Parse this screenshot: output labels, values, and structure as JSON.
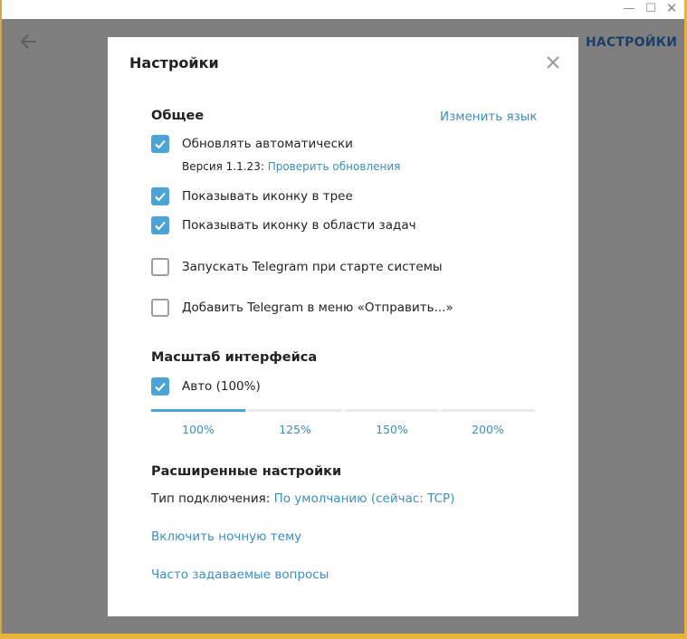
{
  "window": {
    "controls": {
      "minimize": "—",
      "maximize": "☐",
      "close": "✕"
    },
    "header_right": "НАСТРОЙКИ"
  },
  "modal": {
    "title": "Настройки",
    "general": {
      "title": "Общее",
      "change_language": "Изменить язык",
      "auto_update": {
        "label": "Обновлять автоматически",
        "checked": true
      },
      "version_prefix": "Версия 1.1.23:",
      "check_updates": "Проверить обновления",
      "tray_icon": {
        "label": "Показывать иконку в трее",
        "checked": true
      },
      "taskbar_icon": {
        "label": "Показывать иконку в области задач",
        "checked": true
      },
      "autostart": {
        "label": "Запускать Telegram при старте системы",
        "checked": false
      },
      "send_to_menu": {
        "label": "Добавить Telegram в меню «Отправить...»",
        "checked": false
      }
    },
    "scale": {
      "title": "Масштаб интерфейса",
      "auto": {
        "label": "Авто (100%)",
        "checked": true
      },
      "options": [
        "100%",
        "125%",
        "150%",
        "200%"
      ],
      "selected_index": 0
    },
    "advanced": {
      "title": "Расширенные настройки",
      "connection_prefix": "Тип подключения:",
      "connection_value": "По умолчанию (сейчас: TCP)",
      "night_mode": "Включить ночную тему",
      "faq": "Часто задаваемые вопросы"
    }
  },
  "colors": {
    "accent": "#4ba3d6",
    "link": "#3b8ec4",
    "overlay": "#7f7f7f",
    "header_text": "#1b3f66"
  },
  "icons": {
    "back": "arrow-left-icon",
    "close": "close-icon",
    "check": "checkmark-icon"
  }
}
